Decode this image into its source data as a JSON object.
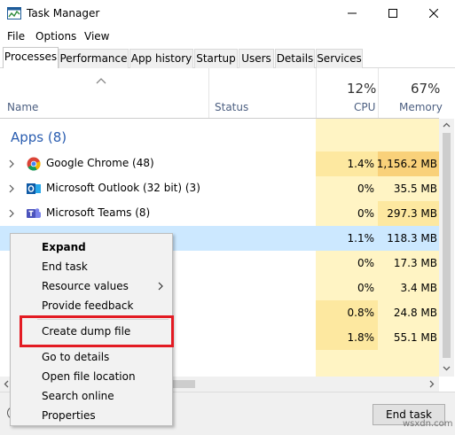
{
  "window": {
    "title": "Task Manager",
    "app_icon": "task-manager-icon"
  },
  "menu": [
    "File",
    "Options",
    "View"
  ],
  "tabs": [
    "Processes",
    "Performance",
    "App history",
    "Startup",
    "Users",
    "Details",
    "Services"
  ],
  "active_tab": "Processes",
  "columns": {
    "name": "Name",
    "status": "Status",
    "cpu_label": "CPU",
    "cpu_total": "12%",
    "memory_label": "Memory",
    "memory_total": "67%"
  },
  "group": {
    "label": "Apps (8)"
  },
  "rows": [
    {
      "name": "Google Chrome (48)",
      "icon": "chrome-icon",
      "cpu": "1.4%",
      "memory": "1,156.2 MB"
    },
    {
      "name": "Microsoft Outlook (32 bit) (3)",
      "icon": "outlook-icon",
      "cpu": "0%",
      "memory": "35.5 MB"
    },
    {
      "name": "Microsoft Teams (8)",
      "icon": "teams-icon",
      "cpu": "0%",
      "memory": "297.3 MB"
    },
    {
      "name": "",
      "icon": "word-icon",
      "cpu": "1.1%",
      "memory": "118.3 MB",
      "selected": true
    },
    {
      "name": "",
      "icon": "",
      "cpu": "0%",
      "memory": "17.3 MB"
    },
    {
      "name": "",
      "icon": "",
      "cpu": "0%",
      "memory": "3.4 MB"
    },
    {
      "name": "",
      "icon": "",
      "cpu": "0.8%",
      "memory": "24.8 MB"
    },
    {
      "name": "",
      "icon": "",
      "cpu": "1.8%",
      "memory": "55.1 MB"
    }
  ],
  "context_menu": {
    "items": [
      {
        "label": "Expand",
        "bold": true
      },
      {
        "label": "End task"
      },
      {
        "label": "Resource values",
        "submenu": true
      },
      {
        "label": "Provide feedback"
      },
      {
        "label": "Create dump file",
        "highlighted": true
      },
      {
        "label": "Go to details"
      },
      {
        "label": "Open file location"
      },
      {
        "label": "Search online"
      },
      {
        "label": "Properties"
      }
    ]
  },
  "buttons": {
    "end_task": "End task"
  },
  "watermark": "wsxdn.com",
  "colors": {
    "highlight_box": "#e31b23",
    "resource_column": "#fff4c4",
    "selection": "#cce8ff",
    "group_label": "#2a5db0"
  }
}
